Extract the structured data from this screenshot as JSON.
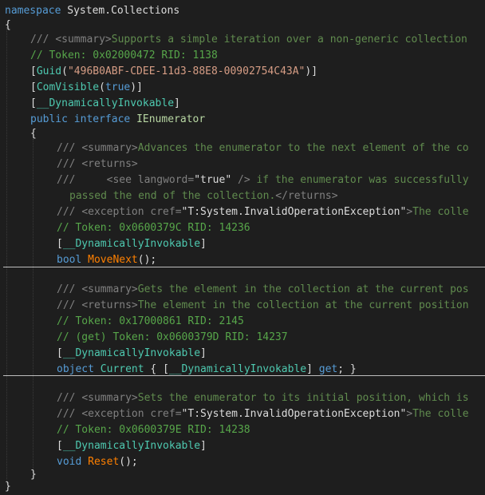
{
  "code": {
    "namespace_kw": "namespace",
    "namespace_name": "System.Collections",
    "open_brace": "{",
    "close_brace": "}",
    "iface_summary_prefix": "/// ",
    "iface_summary_tag": "<summary>",
    "iface_summary_text": "Supports a simple iteration over a non-generic collection",
    "iface_token": "// Token: 0x02000472 RID: 1138",
    "guid_attr_name": "Guid",
    "guid_value": "\"496B0ABF-CDEE-11d3-88E8-00902754C43A\"",
    "comvisible_attr_name": "ComVisible",
    "comvisible_value": "true",
    "dyn_attr_name": "__DynamicallyInvokable",
    "public_kw": "public",
    "interface_kw": "interface",
    "iface_name": "IEnumerator",
    "movenext": {
      "summary_prefix": "/// ",
      "summary_tag": "<summary>",
      "summary_text": "Advances the enumerator to the next element of the co",
      "returns_prefix": "/// ",
      "returns_tag": "<returns>",
      "see_prefix": "///     ",
      "see_tag_open": "<see langword=",
      "see_value": "\"true\"",
      "see_tag_close": " />",
      "see_text": " if the enumerator was successfully",
      "cont_text": "passed the end of the collection.",
      "returns_close": "</returns>",
      "exception_prefix": "/// ",
      "exception_tag_open": "<exception cref=",
      "exception_value": "\"T:System.InvalidOperationException\"",
      "exception_tag_close": ">",
      "exception_text": "The colle",
      "token": "// Token: 0x0600379C RID: 14236",
      "return_type": "bool",
      "name": "MoveNext",
      "tail": "();"
    },
    "current": {
      "summary_prefix": "/// ",
      "summary_tag": "<summary>",
      "summary_text": "Gets the element in the collection at the current pos",
      "returns_prefix": "/// ",
      "returns_tag": "<returns>",
      "returns_text": "The element in the collection at the current position",
      "token": "// Token: 0x17000861 RID: 2145",
      "get_token": "// (get) Token: 0x0600379D RID: 14237",
      "type": "object",
      "name": "Current",
      "open": " { [",
      "close": "] ",
      "get_kw": "get",
      "end": "; }"
    },
    "reset": {
      "summary_prefix": "/// ",
      "summary_tag": "<summary>",
      "summary_text": "Sets the enumerator to its initial position, which is",
      "exception_prefix": "/// ",
      "exception_tag_open": "<exception cref=",
      "exception_value": "\"T:System.InvalidOperationException\"",
      "exception_tag_close": ">",
      "exception_text": "The colle",
      "token": "// Token: 0x0600379E RID: 14238",
      "return_type": "void",
      "name": "Reset",
      "tail": "();"
    }
  }
}
